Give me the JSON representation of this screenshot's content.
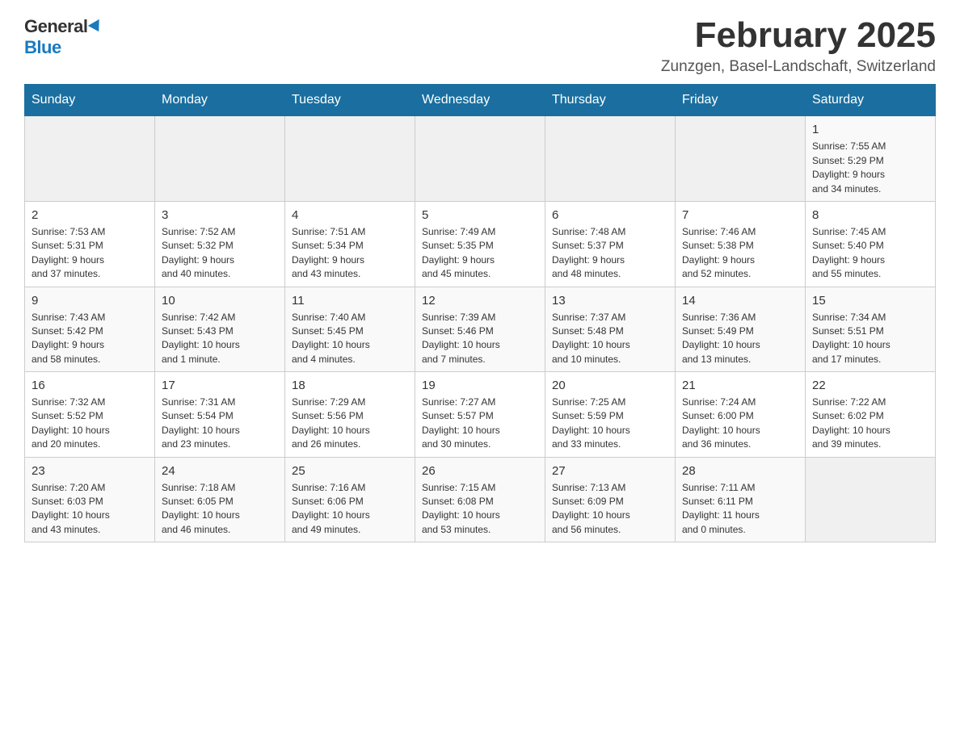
{
  "logo": {
    "general": "General",
    "blue": "Blue",
    "triangle_decoration": "▶"
  },
  "title": {
    "month_year": "February 2025",
    "location": "Zunzgen, Basel-Landschaft, Switzerland"
  },
  "weekdays": [
    "Sunday",
    "Monday",
    "Tuesday",
    "Wednesday",
    "Thursday",
    "Friday",
    "Saturday"
  ],
  "weeks": [
    [
      {
        "day": "",
        "info": ""
      },
      {
        "day": "",
        "info": ""
      },
      {
        "day": "",
        "info": ""
      },
      {
        "day": "",
        "info": ""
      },
      {
        "day": "",
        "info": ""
      },
      {
        "day": "",
        "info": ""
      },
      {
        "day": "1",
        "info": "Sunrise: 7:55 AM\nSunset: 5:29 PM\nDaylight: 9 hours\nand 34 minutes."
      }
    ],
    [
      {
        "day": "2",
        "info": "Sunrise: 7:53 AM\nSunset: 5:31 PM\nDaylight: 9 hours\nand 37 minutes."
      },
      {
        "day": "3",
        "info": "Sunrise: 7:52 AM\nSunset: 5:32 PM\nDaylight: 9 hours\nand 40 minutes."
      },
      {
        "day": "4",
        "info": "Sunrise: 7:51 AM\nSunset: 5:34 PM\nDaylight: 9 hours\nand 43 minutes."
      },
      {
        "day": "5",
        "info": "Sunrise: 7:49 AM\nSunset: 5:35 PM\nDaylight: 9 hours\nand 45 minutes."
      },
      {
        "day": "6",
        "info": "Sunrise: 7:48 AM\nSunset: 5:37 PM\nDaylight: 9 hours\nand 48 minutes."
      },
      {
        "day": "7",
        "info": "Sunrise: 7:46 AM\nSunset: 5:38 PM\nDaylight: 9 hours\nand 52 minutes."
      },
      {
        "day": "8",
        "info": "Sunrise: 7:45 AM\nSunset: 5:40 PM\nDaylight: 9 hours\nand 55 minutes."
      }
    ],
    [
      {
        "day": "9",
        "info": "Sunrise: 7:43 AM\nSunset: 5:42 PM\nDaylight: 9 hours\nand 58 minutes."
      },
      {
        "day": "10",
        "info": "Sunrise: 7:42 AM\nSunset: 5:43 PM\nDaylight: 10 hours\nand 1 minute."
      },
      {
        "day": "11",
        "info": "Sunrise: 7:40 AM\nSunset: 5:45 PM\nDaylight: 10 hours\nand 4 minutes."
      },
      {
        "day": "12",
        "info": "Sunrise: 7:39 AM\nSunset: 5:46 PM\nDaylight: 10 hours\nand 7 minutes."
      },
      {
        "day": "13",
        "info": "Sunrise: 7:37 AM\nSunset: 5:48 PM\nDaylight: 10 hours\nand 10 minutes."
      },
      {
        "day": "14",
        "info": "Sunrise: 7:36 AM\nSunset: 5:49 PM\nDaylight: 10 hours\nand 13 minutes."
      },
      {
        "day": "15",
        "info": "Sunrise: 7:34 AM\nSunset: 5:51 PM\nDaylight: 10 hours\nand 17 minutes."
      }
    ],
    [
      {
        "day": "16",
        "info": "Sunrise: 7:32 AM\nSunset: 5:52 PM\nDaylight: 10 hours\nand 20 minutes."
      },
      {
        "day": "17",
        "info": "Sunrise: 7:31 AM\nSunset: 5:54 PM\nDaylight: 10 hours\nand 23 minutes."
      },
      {
        "day": "18",
        "info": "Sunrise: 7:29 AM\nSunset: 5:56 PM\nDaylight: 10 hours\nand 26 minutes."
      },
      {
        "day": "19",
        "info": "Sunrise: 7:27 AM\nSunset: 5:57 PM\nDaylight: 10 hours\nand 30 minutes."
      },
      {
        "day": "20",
        "info": "Sunrise: 7:25 AM\nSunset: 5:59 PM\nDaylight: 10 hours\nand 33 minutes."
      },
      {
        "day": "21",
        "info": "Sunrise: 7:24 AM\nSunset: 6:00 PM\nDaylight: 10 hours\nand 36 minutes."
      },
      {
        "day": "22",
        "info": "Sunrise: 7:22 AM\nSunset: 6:02 PM\nDaylight: 10 hours\nand 39 minutes."
      }
    ],
    [
      {
        "day": "23",
        "info": "Sunrise: 7:20 AM\nSunset: 6:03 PM\nDaylight: 10 hours\nand 43 minutes."
      },
      {
        "day": "24",
        "info": "Sunrise: 7:18 AM\nSunset: 6:05 PM\nDaylight: 10 hours\nand 46 minutes."
      },
      {
        "day": "25",
        "info": "Sunrise: 7:16 AM\nSunset: 6:06 PM\nDaylight: 10 hours\nand 49 minutes."
      },
      {
        "day": "26",
        "info": "Sunrise: 7:15 AM\nSunset: 6:08 PM\nDaylight: 10 hours\nand 53 minutes."
      },
      {
        "day": "27",
        "info": "Sunrise: 7:13 AM\nSunset: 6:09 PM\nDaylight: 10 hours\nand 56 minutes."
      },
      {
        "day": "28",
        "info": "Sunrise: 7:11 AM\nSunset: 6:11 PM\nDaylight: 11 hours\nand 0 minutes."
      },
      {
        "day": "",
        "info": ""
      }
    ]
  ]
}
